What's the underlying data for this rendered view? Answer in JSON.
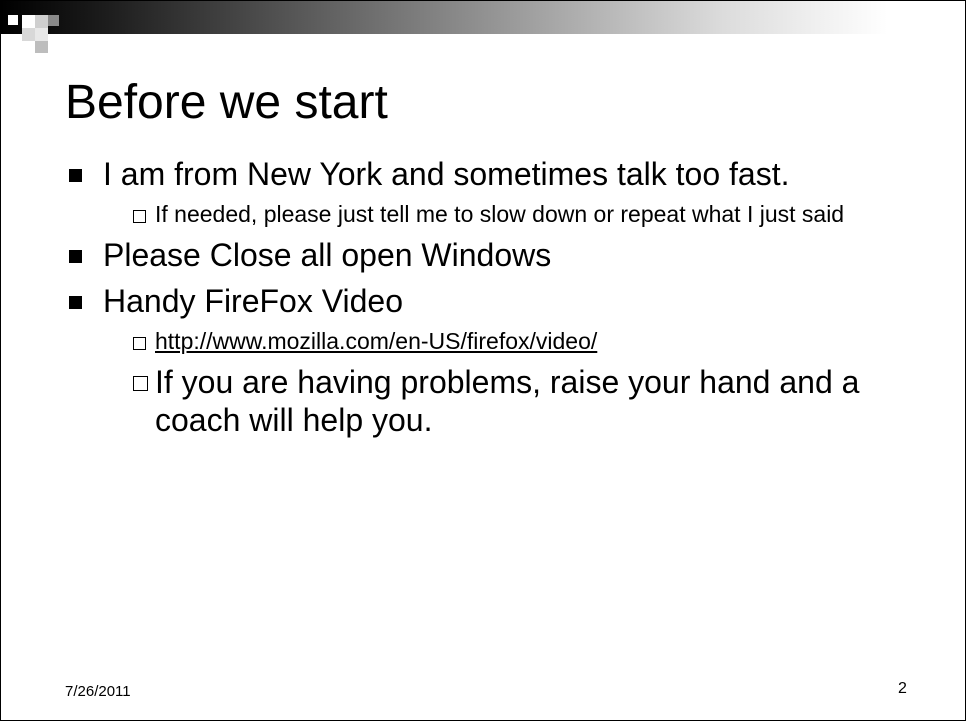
{
  "slide": {
    "title": "Before we start",
    "bullets": [
      {
        "text": "I am from New York and sometimes talk too fast.",
        "sub": [
          {
            "text": "If needed, please just tell me to slow down or repeat what I just said"
          }
        ]
      },
      {
        "text": "Please Close all open Windows",
        "sub": []
      },
      {
        "text": "Handy FireFox Video",
        "sub": [
          {
            "text": "http://www.mozilla.com/en-US/firefox/video/",
            "link": true
          },
          {
            "text": "If you are having problems, raise your hand and a coach will help you."
          }
        ]
      }
    ],
    "footer": {
      "date": "7/26/2011",
      "page_number": "2"
    }
  }
}
